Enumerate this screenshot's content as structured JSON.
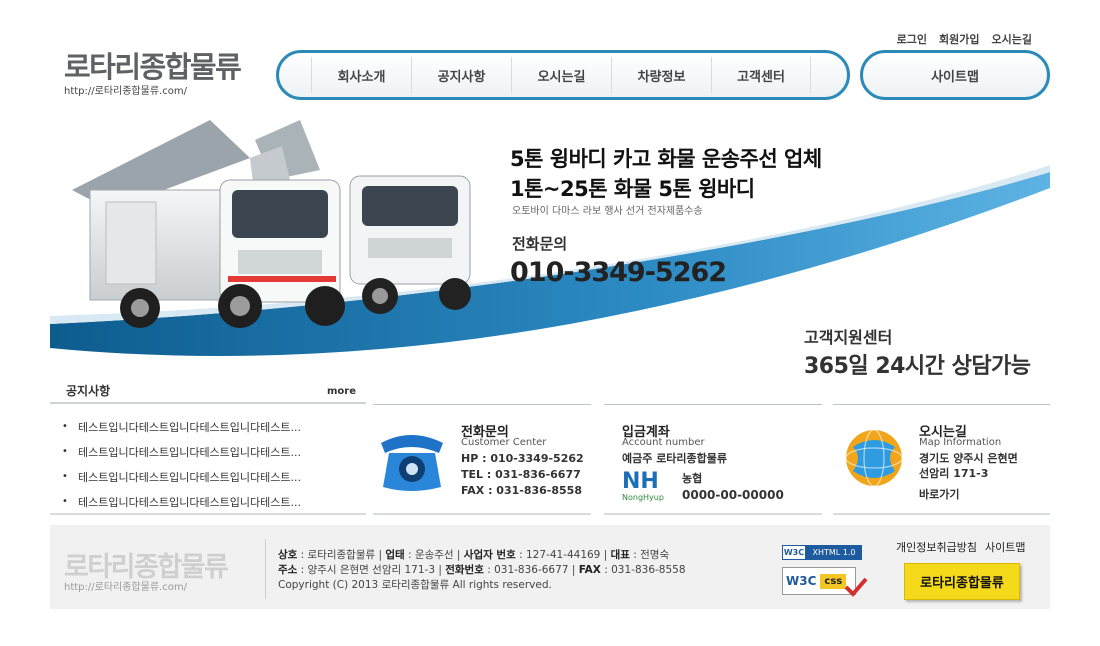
{
  "util_links": [
    "로그인",
    "회원가입",
    "오시는길"
  ],
  "logo": {
    "title": "로타리종합물류",
    "url": "http://로타리종합물류.com/"
  },
  "nav": {
    "items": [
      "회사소개",
      "공지사항",
      "오시는길",
      "차량정보",
      "고객센터"
    ],
    "sitemap": "사이트맵"
  },
  "colors": {
    "accent": "#2b8ab8",
    "wave": "#1a6fa6",
    "footer_bg": "#f1f1f1",
    "badge": "#f5da1b"
  },
  "hero": {
    "headline1": "5톤 윙바디 카고 화물 운송주선 업체",
    "headline2": "1톤~25톤 화물 5톤 윙바디",
    "subline": "오토바이 다마스 라보 행사 선거 전자제품수송",
    "phone_label": "전화문의",
    "phone": "010-3349-5262",
    "cs_title": "고객지원센터",
    "cs_hours": "365일 24시간 상담가능"
  },
  "notice": {
    "title": "공지사항",
    "more": "more",
    "items": [
      "테스트입니다테스트입니다테스트입니다테스트...",
      "테스트입니다테스트입니다테스트입니다테스트...",
      "테스트입니다테스트입니다테스트입니다테스트...",
      "테스트입니다테스트입니다테스트입니다테스트..."
    ],
    "bullet": "•"
  },
  "contact": {
    "title": "전화문의",
    "subtitle": "Customer Center",
    "hp": "HP : 010-3349-5262",
    "tel": "TEL : 031-836-6677",
    "fax": "FAX : 031-836-8558"
  },
  "account": {
    "title": "입금계좌",
    "subtitle": "Account number",
    "holder": "예금주  로타리종합물류",
    "bank_logo": "NH",
    "bank_logo_sub": "NongHyup",
    "bank": "농협",
    "number": "0000-00-00000"
  },
  "map": {
    "title": "오시는길",
    "subtitle": "Map Information",
    "address1": "경기도 양주시 은현면",
    "address2": "선암리 171-3",
    "go": "바로가기"
  },
  "footer": {
    "logo": "로타리종합물류",
    "url": "http://로타리종합물류.com/",
    "line1_label_company": "상호",
    "line1_company": "로타리종합물류",
    "line1_label_business": "업태",
    "line1_business": "운송주선",
    "line1_label_regno": "사업자 번호",
    "line1_regno": "127-41-44169",
    "line1_label_ceo": "대표",
    "line1_ceo": "전명숙",
    "line2_label_addr": "주소",
    "line2_addr": "양주시 은현면 선암리 171-3",
    "line2_label_tel": "전화번호",
    "line2_tel": "031-836-6677",
    "line2_label_fax": "FAX",
    "line2_fax": "031-836-8558",
    "copyright": "Copyright (C) 2013 로타리종합물류 All rights reserved.",
    "links": [
      "개인정보취급방침",
      "사이트맵"
    ],
    "badge": "로타리종합물류",
    "w3c_xhtml": "XHTML 1.0",
    "w3c_mark": "W3C",
    "w3c_css": "css"
  }
}
